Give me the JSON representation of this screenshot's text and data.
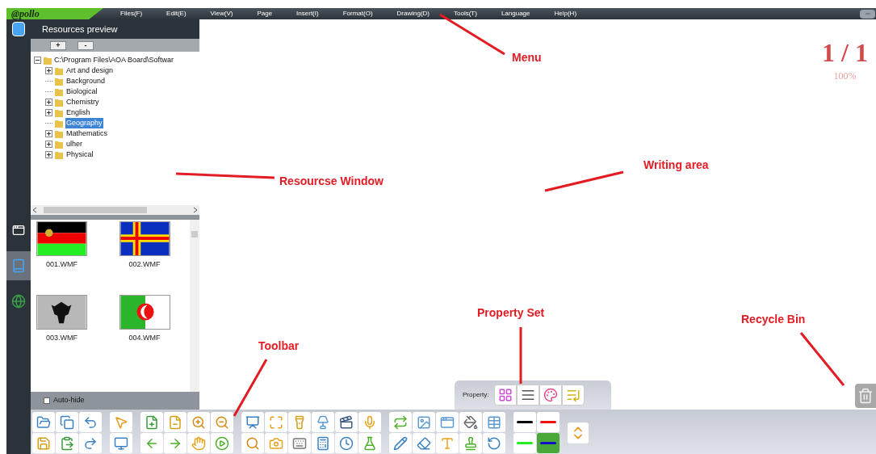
{
  "menu_bar": {
    "logo": "@pollo",
    "items": [
      "Files(F)",
      "Edit(E)",
      "View(V)",
      "Page",
      "Insert(I)",
      "Format(O)",
      "Drawing(D)",
      "Tools(T)",
      "Language",
      "Help(H)"
    ]
  },
  "sidebar_tabs": [
    {
      "selected": false
    },
    {
      "selected": true
    },
    {
      "selected": false
    }
  ],
  "resources_panel": {
    "title": "Resources preview",
    "buttons": [
      "+",
      "-"
    ],
    "tree": {
      "label": "C:\\Program Files\\AOA Board\\Softwar",
      "expanded": true,
      "children": [
        {
          "label": "Art and design",
          "expandable": true,
          "selected": false
        },
        {
          "label": "Background",
          "expandable": false,
          "selected": false
        },
        {
          "label": "Biological",
          "expandable": false,
          "selected": false
        },
        {
          "label": "Chemistry",
          "expandable": true,
          "selected": false
        },
        {
          "label": "English",
          "expandable": true,
          "selected": false
        },
        {
          "label": "Geography",
          "expandable": false,
          "selected": true
        },
        {
          "label": "Mathematics",
          "expandable": true,
          "selected": false
        },
        {
          "label": "ulher",
          "expandable": true,
          "selected": false
        },
        {
          "label": "Physical",
          "expandable": true,
          "selected": false
        }
      ]
    },
    "thumbnails": [
      {
        "label": "001.WMF",
        "kind": "tricolor"
      },
      {
        "label": "002.WMF",
        "kind": "cross"
      },
      {
        "label": "003.WMF",
        "kind": "eagle"
      },
      {
        "label": "004.WMF",
        "kind": "crescent"
      }
    ],
    "auto_hide": {
      "label": "Auto-hide",
      "checked": false
    }
  },
  "page": {
    "counter": "1 / 1",
    "zoom": "100%"
  },
  "property_bar": {
    "label": "Property:"
  },
  "pens": [
    {
      "color": "#000000",
      "selected": false
    },
    {
      "color": "#ee1111",
      "selected": false
    },
    {
      "color": "#22ee22",
      "selected": false
    },
    {
      "color": "#1111cc",
      "selected": true
    }
  ],
  "annotations": [
    {
      "text": "Menu"
    },
    {
      "text": "Resourcse Window"
    },
    {
      "text": "Writing area"
    },
    {
      "text": "Property Set"
    },
    {
      "text": "Recycle Bin"
    },
    {
      "text": "Toolbar"
    }
  ]
}
